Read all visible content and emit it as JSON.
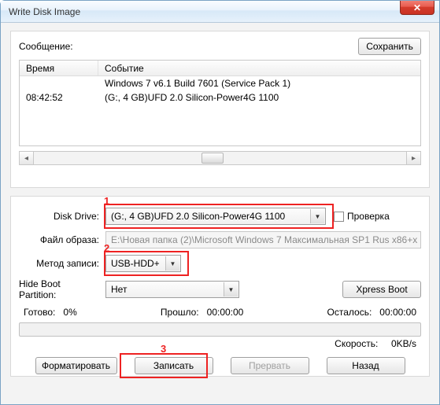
{
  "window": {
    "title": "Write Disk Image",
    "close_symbol": "✕"
  },
  "annotations": {
    "n1": "1",
    "n2": "2",
    "n3": "3"
  },
  "group1": {
    "message_label": "Сообщение:",
    "save_button": "Сохранить",
    "col_time": "Время",
    "col_event": "Событие",
    "rows": [
      {
        "time": "",
        "event": "Windows 7 v6.1 Build 7601 (Service Pack 1)"
      },
      {
        "time": "08:42:52",
        "event": "(G:, 4 GB)UFD 2.0 Silicon-Power4G 1100"
      }
    ]
  },
  "group2": {
    "disk_drive_label": "Disk Drive:",
    "disk_drive_value": "(G:, 4 GB)UFD 2.0 Silicon-Power4G 1100",
    "check_label": "Проверка",
    "image_file_label": "Файл образа:",
    "image_file_value": "E:\\Новая папка (2)\\Microsoft Windows 7 Максимальная SP1 Rus x86+x",
    "write_method_label": "Метод записи:",
    "write_method_value": "USB-HDD+",
    "hide_boot_label": "Hide Boot Partition:",
    "hide_boot_value": "Нет",
    "xpress_boot": "Xpress Boot",
    "ready_label": "Готово:",
    "ready_value": "0%",
    "elapsed_label": "Прошло:",
    "elapsed_value": "00:00:00",
    "remain_label": "Осталось:",
    "remain_value": "00:00:00",
    "speed_label": "Скорость:",
    "speed_value": "0KB/s"
  },
  "buttons": {
    "format": "Форматировать",
    "write": "Записать",
    "abort": "Прервать",
    "back": "Назад"
  }
}
